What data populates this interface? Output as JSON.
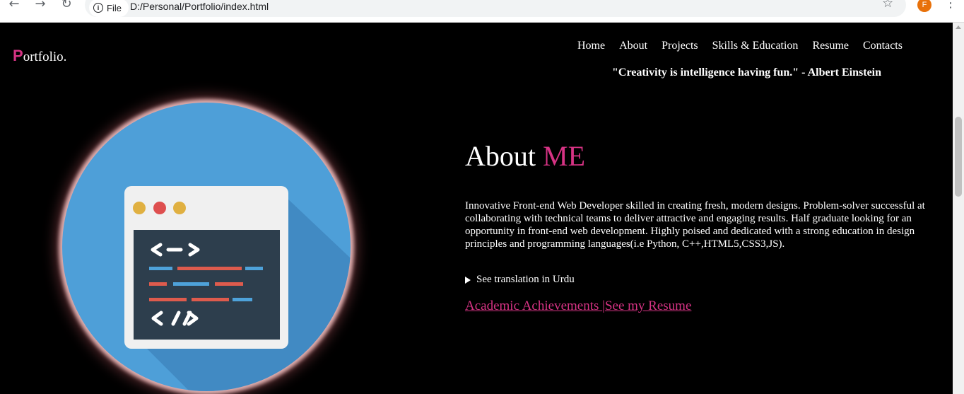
{
  "browser": {
    "back_icon": "back-arrow-icon",
    "forward_icon": "forward-arrow-icon",
    "reload_icon": "reload-icon",
    "site_chip": "File",
    "url": "D:/Personal/Portfolio/index.html",
    "profile_initial": "F",
    "profile_color": "#e8710a"
  },
  "brand": {
    "first_letter": "P",
    "rest": "ortfolio."
  },
  "nav": {
    "items": [
      {
        "label": "Home"
      },
      {
        "label": "About"
      },
      {
        "label": "Projects"
      },
      {
        "label": "Skills & Education"
      },
      {
        "label": "Resume"
      },
      {
        "label": "Contacts"
      }
    ]
  },
  "quote": "\"Creativity is intelligence having fun.\" - Albert Einstein",
  "about": {
    "heading_main": "About",
    "heading_accent": "ME",
    "description": "Innovative Front-end Web Developer skilled in creating fresh, modern designs. Problem-solver successful at collaborating with technical teams to deliver attractive and engaging results. Half graduate looking for an opportunity in front-end web development. Highly poised and dedicated with a strong education in design principles and programming languages(i.e Python, C++,HTML5,CSS3,JS).",
    "translation_toggle": "See translation in Urdu",
    "link_academic": "Academic Achievements ",
    "link_separator": "|",
    "link_resume": "See my Resume"
  },
  "hero": {
    "image": "code-window-illustration"
  },
  "colors": {
    "accent": "#d63384",
    "background": "#000000",
    "circle": "#4e9fd8"
  }
}
